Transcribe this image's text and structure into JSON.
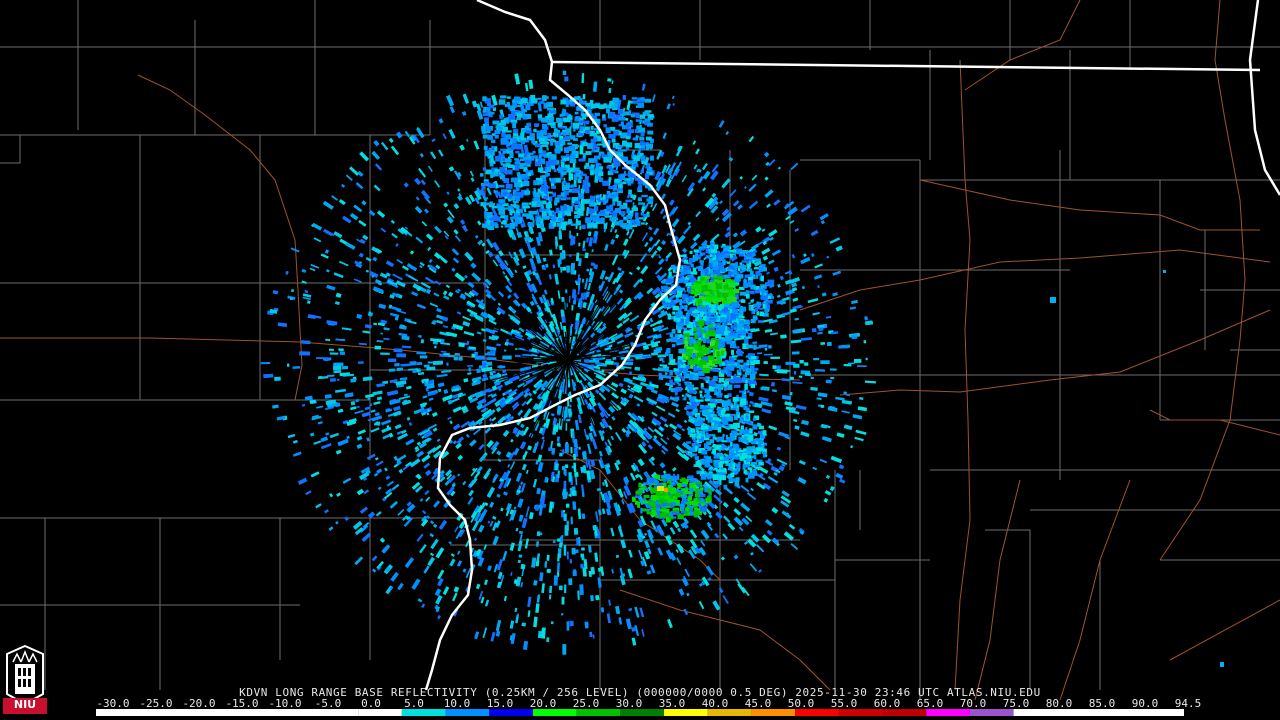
{
  "product": {
    "caption": "KDVN LONG RANGE BASE REFLECTIVITY (0.25KM / 256 LEVEL) (000000/0000 0.5 DEG) 2025-11-30 23:46 UTC  ATLAS.NIU.EDU"
  },
  "logo": {
    "text": "NIU",
    "color": "#c8102e"
  },
  "colors": {
    "background": "#000000",
    "state_border": "#ffffff",
    "county_line": "#6e6e6e",
    "highway": "#a0522d"
  },
  "colorbar": {
    "labels": [
      "-30.0",
      "-25.0",
      "-20.0",
      "-15.0",
      "-10.0",
      "-5.0",
      "0.0",
      "5.0",
      "10.0",
      "15.0",
      "20.0",
      "25.0",
      "30.0",
      "35.0",
      "40.0",
      "45.0",
      "50.0",
      "55.0",
      "60.0",
      "65.0",
      "70.0",
      "75.0",
      "80.0",
      "85.0",
      "90.0",
      "94.5"
    ],
    "stops": [
      {
        "value": -30,
        "color": "#ffffff"
      },
      {
        "value": 0,
        "color": "#ffffff"
      },
      {
        "value": 5,
        "color": "#00e0e0"
      },
      {
        "value": 10,
        "color": "#0090ff"
      },
      {
        "value": 15,
        "color": "#0000f0"
      },
      {
        "value": 20,
        "color": "#00ff00"
      },
      {
        "value": 25,
        "color": "#00c000"
      },
      {
        "value": 30,
        "color": "#008000"
      },
      {
        "value": 35,
        "color": "#ffff00"
      },
      {
        "value": 40,
        "color": "#e6b800"
      },
      {
        "value": 45,
        "color": "#ff9000"
      },
      {
        "value": 50,
        "color": "#ff0000"
      },
      {
        "value": 55,
        "color": "#d00000"
      },
      {
        "value": 60,
        "color": "#c00000"
      },
      {
        "value": 65,
        "color": "#ff00ff"
      },
      {
        "value": 70,
        "color": "#9955c9"
      },
      {
        "value": 75,
        "color": "#ffffff"
      },
      {
        "value": 94.5,
        "color": "#ffffff"
      }
    ]
  }
}
